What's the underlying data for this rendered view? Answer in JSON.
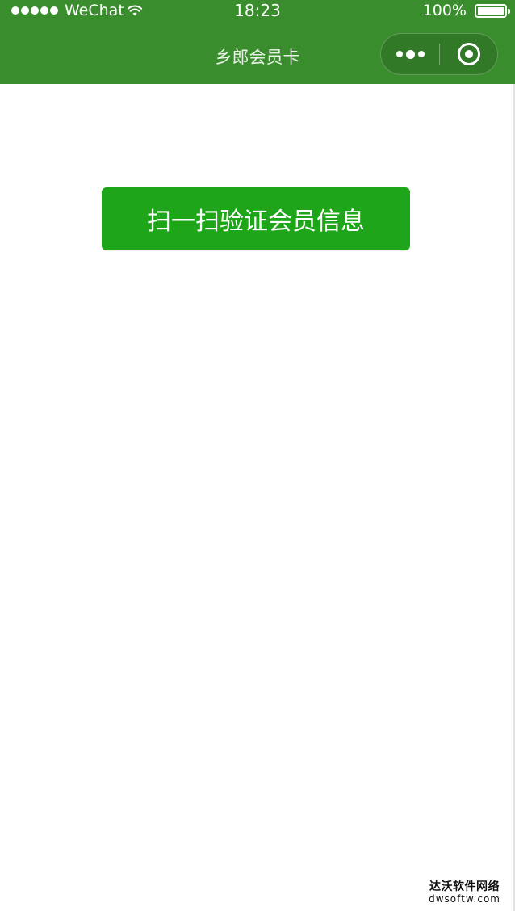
{
  "status_bar": {
    "carrier": "WeChat",
    "time": "18:23",
    "battery": "100%"
  },
  "nav": {
    "title": "乡郎会员卡"
  },
  "main": {
    "scan_button_label": "扫一扫验证会员信息"
  },
  "watermark": {
    "cn": "达沃软件网络",
    "en": "dwsoftw.com"
  },
  "colors": {
    "nav_bar": "#3a8d2d",
    "primary_button": "#1fa51a",
    "background": "#ffffff"
  },
  "icons": [
    "signal-dots-icon",
    "wifi-icon",
    "battery-icon",
    "more-dots-icon",
    "target-close-icon"
  ]
}
